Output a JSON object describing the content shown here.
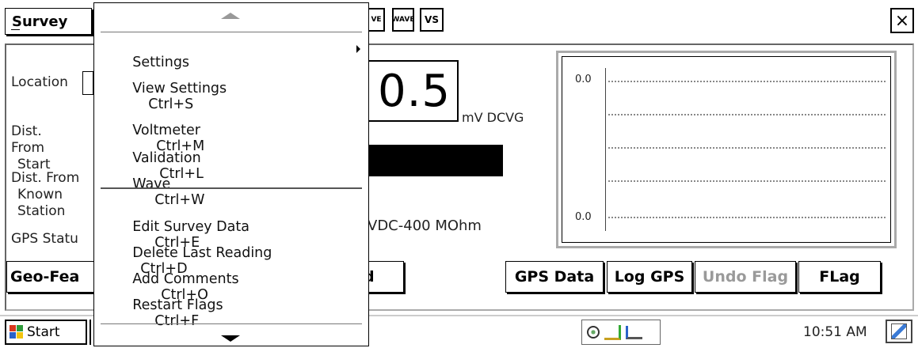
{
  "titlebar": {
    "survey_menu": "Survey",
    "icon_btns": [
      "VE",
      "WAVE",
      "VS"
    ],
    "close": "×"
  },
  "left_panel": {
    "location": "Location",
    "dist_start": [
      "Dist. From",
      "Start"
    ],
    "dist_known": [
      "Dist. From",
      "Known",
      "Station"
    ],
    "gps_status": "GPS Statu"
  },
  "reading": {
    "value": "0.5",
    "unit": "mV DCVG",
    "meter_info": "VDC-400 MOhm"
  },
  "graph": {
    "top_label": "0.0",
    "bottom_label": "0.0"
  },
  "buttons": {
    "geo_features": "Geo-Fea",
    "partial_button": "d",
    "gps_data": "GPS Data",
    "log_gps": "Log GPS",
    "undo_flag": "Undo Flag",
    "flag": "FLag"
  },
  "menu": {
    "items": [
      {
        "label": "Settings",
        "shortcut": "",
        "submenu": true
      },
      {
        "label": "View Settings",
        "shortcut": "Ctrl+S"
      },
      {
        "label": "Voltmeter",
        "shortcut": "Ctrl+M"
      },
      {
        "label": "Validation",
        "shortcut": "Ctrl+L"
      },
      {
        "label": "Wave",
        "shortcut": "Ctrl+W"
      },
      {
        "label": "Edit Survey Data",
        "shortcut": "Ctrl+E"
      },
      {
        "label": "Delete Last Reading",
        "shortcut": "Ctrl+D"
      },
      {
        "label": "Add Comments",
        "shortcut": "Ctrl+O"
      },
      {
        "label": "Restart Flags",
        "shortcut": "Ctrl+F"
      }
    ]
  },
  "taskbar": {
    "start": "Start",
    "time": "10:51 AM"
  },
  "colors": {
    "undo_flag_text": "#9a9a9a",
    "black_bar": "#000000"
  }
}
